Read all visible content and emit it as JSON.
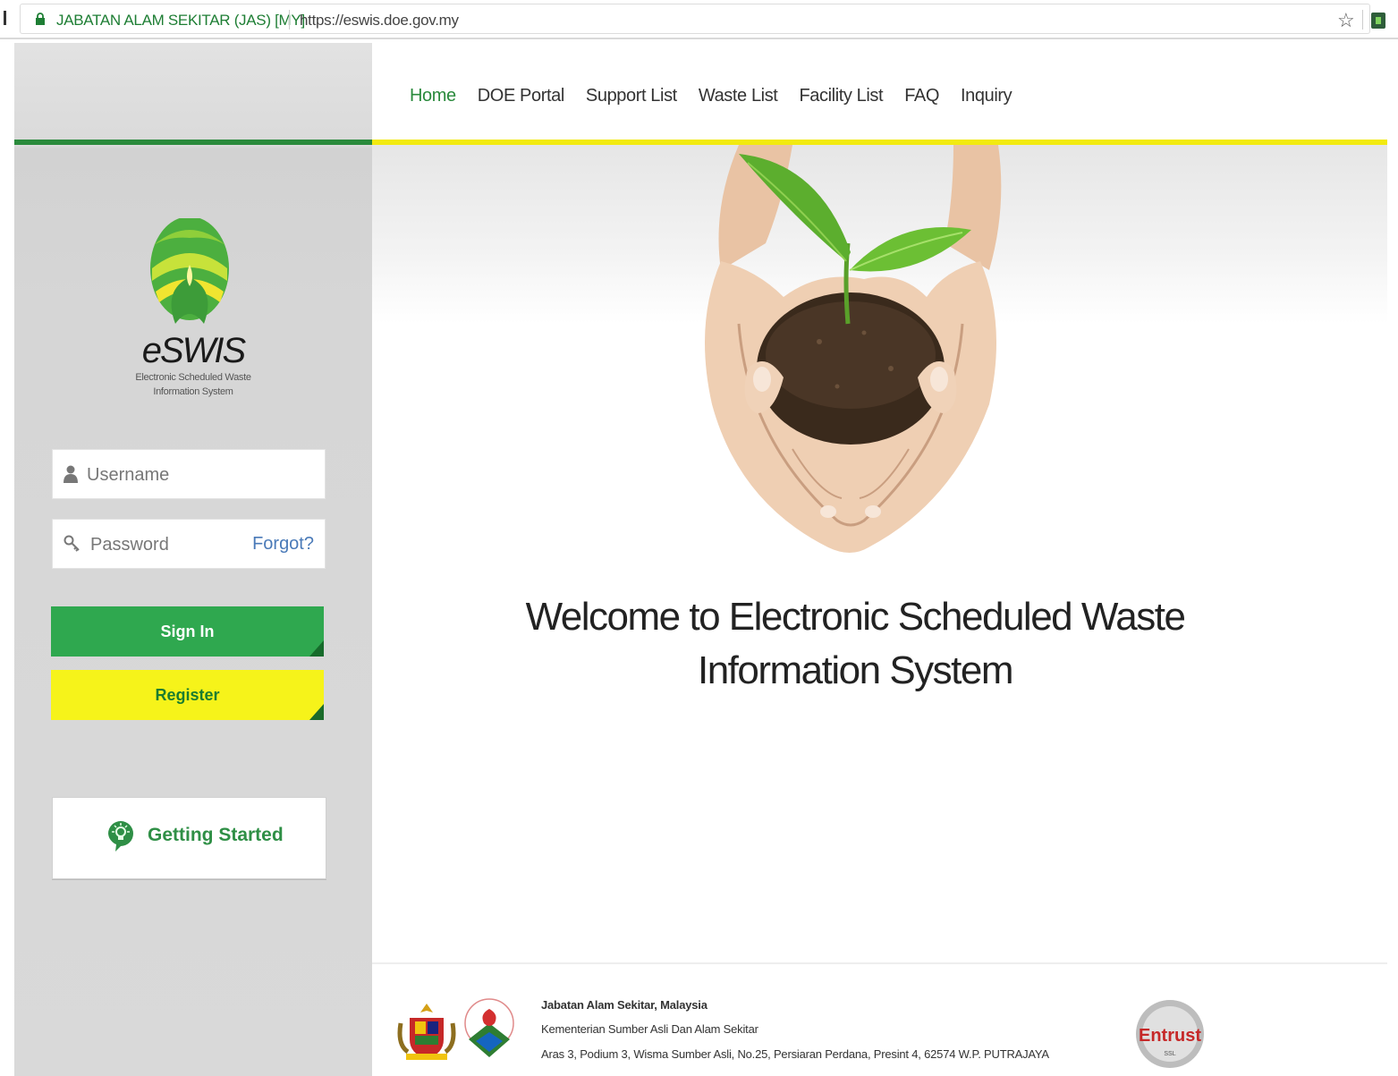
{
  "browser": {
    "site_name": "JABATAN ALAM SEKITAR (JAS) [MY]",
    "url": "https://eswis.doe.gov.my",
    "icons": [
      "lock-icon",
      "star-icon",
      "extension-icon"
    ]
  },
  "sidebar": {
    "logo_title": "eSWIS",
    "logo_subtitle_1": "Electronic Scheduled Waste",
    "logo_subtitle_2": "Information System",
    "username_placeholder": "Username",
    "password_placeholder": "Password",
    "forgot_label": "Forgot?",
    "signin_label": "Sign In",
    "register_label": "Register",
    "getting_started_label": "Getting Started"
  },
  "nav": {
    "items": [
      {
        "label": "Home",
        "active": true
      },
      {
        "label": "DOE Portal",
        "active": false
      },
      {
        "label": "Support List",
        "active": false
      },
      {
        "label": "Waste List",
        "active": false
      },
      {
        "label": "Facility List",
        "active": false
      },
      {
        "label": "FAQ",
        "active": false
      },
      {
        "label": "Inquiry",
        "active": false
      }
    ]
  },
  "main": {
    "welcome_line_1": "Welcome to Electronic Scheduled Waste",
    "welcome_line_2": "Information System"
  },
  "footer": {
    "org": "Jabatan Alam Sekitar, Malaysia",
    "ministry": "Kementerian Sumber Asli Dan Alam Sekitar",
    "address": "Aras 3, Podium 3, Wisma Sumber Asli, No.25, Persiaran Perdana, Presint 4, 62574 W.P. PUTRAJAYA",
    "seal_text": "Entrust",
    "seal_subtext": "SSL"
  },
  "colors": {
    "brand_green": "#2fa84f",
    "nav_active": "#2a8a3c",
    "accent_yellow": "#f2ea10",
    "link_blue": "#4a7ab8"
  }
}
